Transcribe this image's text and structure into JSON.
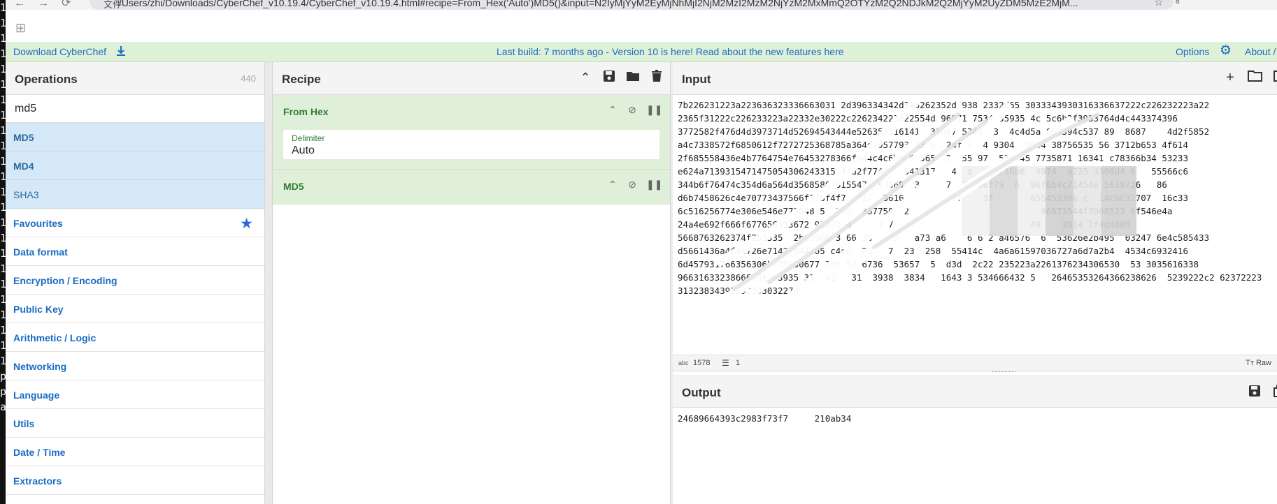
{
  "browser": {
    "url_lead": "文件",
    "url": "/Users/zhi/Downloads/CyberChef_v10.19.4/CyberChef_v10.19.4.html#recipe=From_Hex('Auto')MD5()&input=N2IyMjYyM2EyMjNhMjI2NjM2MzI2MzM2NjYzM2MxMmQ2OTYzM2Q2NDJkM2Q2MjYyM2UyZDM5MzE2MjM..."
  },
  "terminal_strip": [
    "1",
    "1",
    "1",
    "1",
    "1",
    "1",
    "1",
    "1",
    "1",
    "1",
    "1",
    "1",
    "1",
    "1",
    "1",
    "1",
    "1",
    "1",
    "1",
    "1",
    "1",
    "1",
    "1",
    "1",
    "p",
    "p",
    "a"
  ],
  "banner": {
    "download_label": "Download CyberChef",
    "build_message": "Last build: 7 months ago - Version 10 is here! Read about the new features here",
    "options_label": "Options",
    "about_label": "About / S"
  },
  "operations": {
    "title": "Operations",
    "count": "440",
    "search_value": "md5",
    "results": [
      {
        "label": "MD5",
        "bold": true
      },
      {
        "label": "MD4",
        "bold": true
      },
      {
        "label": "SHA3",
        "bold": false
      }
    ],
    "categories": [
      "Favourites",
      "Data format",
      "Encryption / Encoding",
      "Public Key",
      "Arithmetic / Logic",
      "Networking",
      "Language",
      "Utils",
      "Date / Time",
      "Extractors"
    ]
  },
  "recipe": {
    "title": "Recipe",
    "steps": [
      {
        "name": "From Hex",
        "arg_label": "Delimiter",
        "arg_value": "Auto"
      },
      {
        "name": "MD5"
      }
    ]
  },
  "input": {
    "title": "Input",
    "lines": [
      "7b226231223a223636323336663031 2d396334342d346262352d 938 2332d65 3033343930316336637222c226232223a22",
      "2365f31222c226233223a22332e30222c226234223a22554d 96971 7534 55935 4c 5c6b2f3933764d4c443374396",
      "3772582f476d4d3973714d52694543444e526353316141  31667 5348  3  4c4d5a 053394c537 89  8687    4d2f5852",
      "a4c7338572f6850612f7272725368785a364d7957793 23 5  24f 3  4 9304  0844 38756535 56 3712b653 4f614",
      "2f685558436e4b7764754e76453278366f644c4c6b5 5 565  2  55 97  539545 7735871 16341 c78366b34 53233",
      "e624a7139315471475054306243315 44d2f7748   941317   4  d  c63716b6  4974  a735 3306d4 6   55566c6",
      "344b6f76474c354d6a564d35685867615547  53869  3     7  71666f79  6  96f6b4c71454e 5639726   86",
      "d6b7458626c4e70773437566f376f4f7   17  3616         3f    3f       655452396 c  14c6c32707  16c33",
      "6c516256774e306e546e773048 5  26a  387750  2                         86673544f7068523 6f546e4a",
      "24a4e692f666f677656333672 93870 4     3 7                          49    3914 2f4d4669",
      "5668763262374f2b3335  2b33566 3 66 36   73   a73 a6    6 6 2 a46576  6  53626e2b495  03247 6e4c585433",
      "d5661436a4f4e726e71437944305 c4e6  73   7  23  258  55414c  4a6a61597036727a6d7a2b4  4534c6932416",
      "6d457931766356306b775050677 386 52 6736  53657  5  d3d  2c22 235223a2261376234306530  53 3035616338",
      "96631633238666631383935 31  43   31  3938  3834   1643 3 534666432 5   26465353264366238626  5239222c2 62372223",
      "3132383439313230303227d"
    ],
    "length": "1578",
    "lines_count": "1",
    "format": "Raw"
  },
  "output": {
    "title": "Output",
    "value": "24689664393c2983f73f7     210ab34"
  },
  "colors": {
    "banner_bg": "#dff0d8",
    "link": "#1a6cc4",
    "step_bg": "#e0efd9",
    "step_name": "#2e7d32",
    "selected_bg": "#d5e8f7",
    "star": "#2a6ccf"
  }
}
